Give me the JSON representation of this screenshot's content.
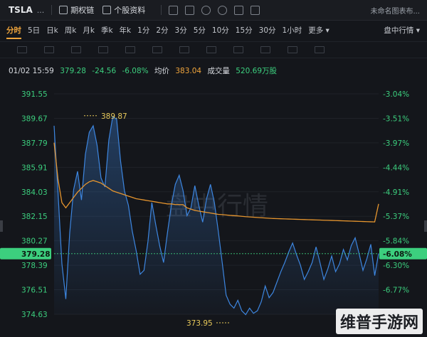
{
  "topbar": {
    "ticker": "TSLA",
    "ticker_more": "...",
    "btn_rights": "期权链",
    "btn_profile": "个股资料",
    "layout_name": "未命名图表布..."
  },
  "tabs": [
    "分时",
    "5日",
    "日k",
    "周k",
    "月k",
    "季k",
    "年k",
    "1分",
    "2分",
    "3分",
    "5分",
    "10分",
    "15分",
    "30分",
    "1小时",
    "更多 ▾"
  ],
  "tabs_right": "盘中行情 ▾",
  "info": {
    "datetime": "01/02 15:59",
    "price": "379.28",
    "change": "-24.56",
    "change_pct": "-6.08%",
    "avg_label": "均价",
    "avg_value": "383.04",
    "volume_label": "成交量",
    "volume_value": "520.69万股"
  },
  "chart_data": {
    "type": "line",
    "left_axis_ticks": [
      "391.55",
      "389.67",
      "387.79",
      "385.91",
      "384.03",
      "382.15",
      "380.27",
      "378.39",
      "376.51",
      "374.63"
    ],
    "right_axis_ticks": [
      "-3.04%",
      "-3.51%",
      "-3.97%",
      "-4.44%",
      "-4.91%",
      "-5.37%",
      "-5.84%",
      "-6.30%",
      "-6.77%"
    ],
    "ylim": [
      374.63,
      391.55
    ],
    "current_price_label": "379.28",
    "current_pct_label": "-6.08%",
    "high_label": "389.87",
    "low_label": "373.95",
    "watermark": "盘中行情",
    "series": [
      {
        "name": "price",
        "values": [
          389.1,
          384.0,
          378.5,
          375.8,
          380.9,
          384.2,
          385.6,
          383.4,
          386.9,
          388.6,
          389.1,
          387.6,
          385.1,
          384.4,
          388.0,
          389.8,
          389.6,
          386.4,
          384.1,
          383.0,
          381.0,
          379.5,
          377.7,
          378.0,
          380.2,
          383.2,
          381.5,
          379.9,
          378.6,
          380.9,
          383.0,
          384.6,
          385.3,
          384.1,
          382.2,
          382.8,
          384.5,
          383.0,
          381.7,
          383.5,
          384.6,
          383.2,
          381.0,
          378.6,
          376.1,
          375.4,
          375.1,
          375.7,
          374.9,
          374.6,
          375.1,
          374.7,
          374.9,
          375.6,
          376.8,
          375.9,
          376.3,
          377.1,
          377.9,
          378.6,
          379.4,
          380.1,
          379.2,
          378.4,
          377.3,
          377.9,
          378.6,
          379.8,
          378.6,
          377.3,
          378.1,
          379.1,
          377.9,
          378.5,
          379.6,
          378.8,
          379.9,
          380.5,
          379.3,
          378.0,
          378.9,
          380.0,
          377.6,
          379.3
        ]
      },
      {
        "name": "avg",
        "values": [
          387.8,
          385.0,
          383.2,
          382.8,
          383.2,
          383.6,
          384.0,
          384.3,
          384.6,
          384.8,
          384.9,
          384.8,
          384.7,
          384.5,
          384.3,
          384.1,
          384.0,
          383.9,
          383.8,
          383.7,
          383.6,
          383.5,
          383.45,
          383.4,
          383.35,
          383.3,
          383.25,
          383.2,
          383.15,
          383.1,
          383.1,
          383.05,
          383.05,
          383.04,
          382.8,
          382.7,
          382.6,
          382.55,
          382.5,
          382.45,
          382.4,
          382.35,
          382.3,
          382.28,
          382.25,
          382.22,
          382.2,
          382.18,
          382.15,
          382.12,
          382.1,
          382.08,
          382.06,
          382.04,
          382.02,
          382.0,
          381.98,
          381.97,
          381.96,
          381.95,
          381.94,
          381.93,
          381.92,
          381.91,
          381.9,
          381.89,
          381.88,
          381.87,
          381.86,
          381.85,
          381.84,
          381.83,
          381.82,
          381.81,
          381.8,
          381.79,
          381.78,
          381.77,
          381.76,
          381.75,
          381.74,
          381.73,
          381.72,
          383.1
        ]
      }
    ],
    "colors": {
      "price": "#3d86e0",
      "avg": "#e6952e",
      "up": "#3ccf7e",
      "label_bg": "#3ccf7e"
    }
  },
  "watermark_corner": "维普手游网"
}
